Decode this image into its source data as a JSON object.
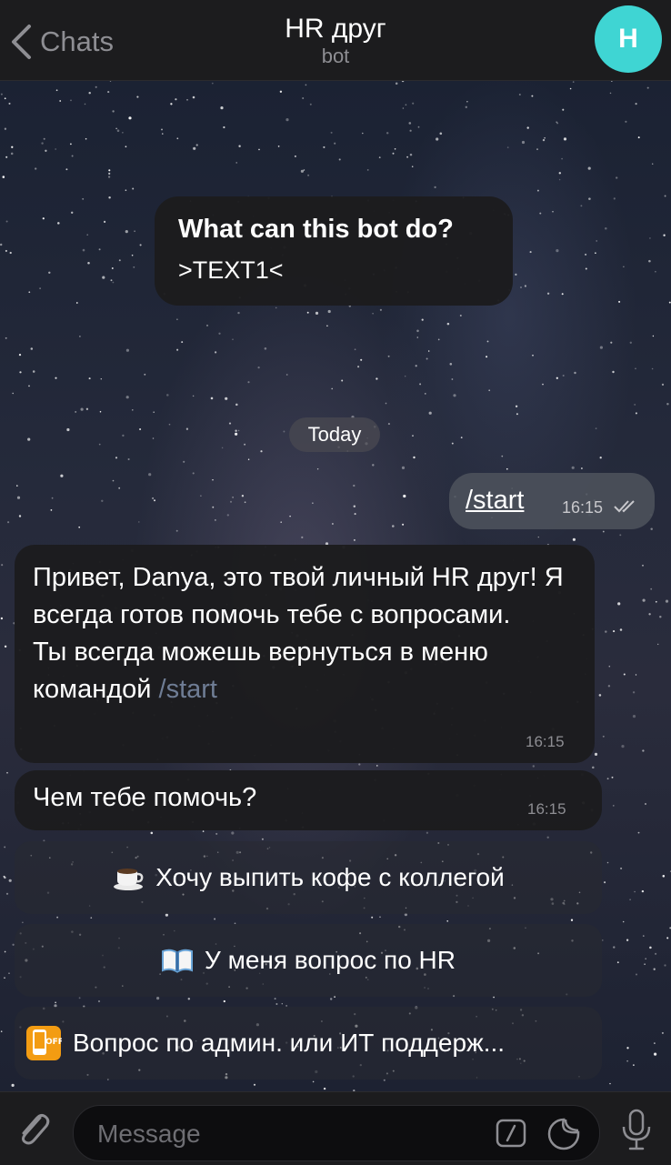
{
  "header": {
    "back_label": "Chats",
    "title": "HR друг",
    "subtitle": "bot",
    "avatar_letter": "H",
    "avatar_color": "#3fd5d3"
  },
  "intro": {
    "heading": "What can this bot do?",
    "text": ">TEXT1<"
  },
  "date_label": "Today",
  "outgoing": {
    "text": "/start",
    "time": "16:15"
  },
  "messages": [
    {
      "text": "Привет, Danya, это твой личный HR друг! Я всегда готов помочь тебе с вопросами.\nТы всегда можешь вернуться в меню командой ",
      "link": "/start",
      "time": "16:15"
    },
    {
      "text": "Чем тебе помочь?",
      "time": "16:15"
    }
  ],
  "keyboard": [
    {
      "icon": "coffee-cup-icon",
      "label": "Хочу выпить кофе с коллегой"
    },
    {
      "icon": "open-book-icon",
      "label": "У меня вопрос по HR"
    },
    {
      "icon": "phone-off-icon",
      "label": "Вопрос по админ. или ИТ поддерж..."
    }
  ],
  "input": {
    "placeholder": "Message"
  }
}
